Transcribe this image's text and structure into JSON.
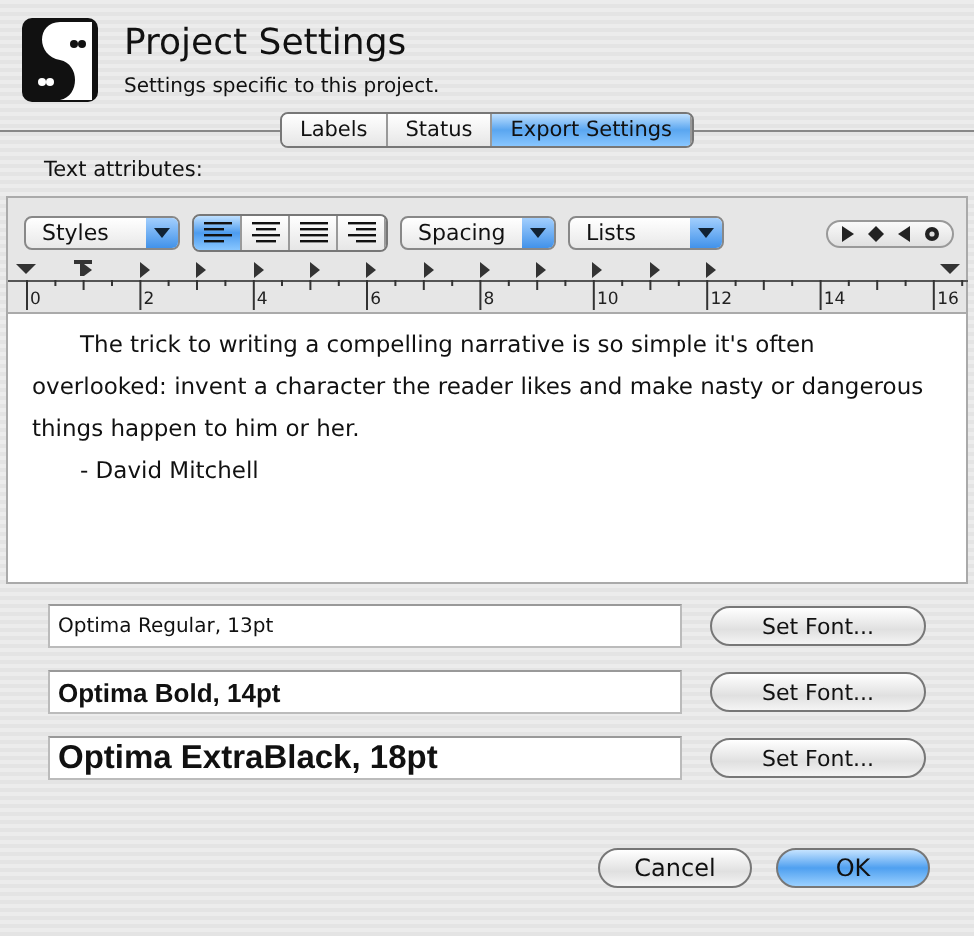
{
  "header": {
    "title": "Project Settings",
    "subtitle": "Settings specific to this project."
  },
  "tabs": [
    {
      "label": "Labels",
      "selected": false
    },
    {
      "label": "Status",
      "selected": false
    },
    {
      "label": "Export Settings",
      "selected": true
    }
  ],
  "section_label": "Text attributes:",
  "toolbar": {
    "styles": "Styles",
    "spacing": "Spacing",
    "lists": "Lists",
    "alignment": [
      {
        "kind": "left",
        "selected": true
      },
      {
        "kind": "center",
        "selected": false
      },
      {
        "kind": "justify",
        "selected": false
      },
      {
        "kind": "right",
        "selected": false
      }
    ]
  },
  "ruler": {
    "labels": [
      "0",
      "2",
      "4",
      "6",
      "8",
      "10",
      "12",
      "14",
      "16"
    ]
  },
  "text": {
    "paragraphs": [
      {
        "text": "The trick to writing a compelling narrative is so simple it's often overlooked: invent a character the reader likes and make nasty or dangerous things happen to him or her."
      },
      {
        "text": "- David Mitchell"
      }
    ]
  },
  "fonts": [
    {
      "kind": "regular",
      "value": "Optima Regular, 13pt",
      "button": "Set Font..."
    },
    {
      "kind": "bold",
      "value": "Optima Bold, 14pt",
      "button": "Set Font..."
    },
    {
      "kind": "black",
      "value": "Optima ExtraBlack, 18pt",
      "button": "Set Font..."
    }
  ],
  "buttons": [
    {
      "label": "Cancel",
      "kind": "normal"
    },
    {
      "label": "OK",
      "kind": "default"
    }
  ]
}
